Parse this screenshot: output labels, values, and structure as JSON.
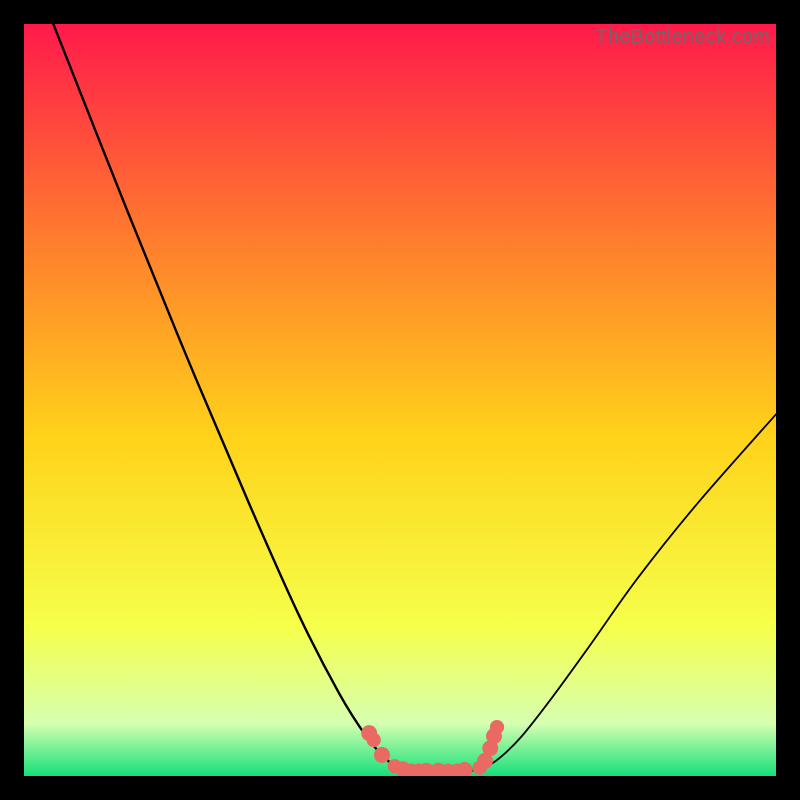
{
  "watermark": "TheBottleneck.com",
  "palette": {
    "bg": "#000000",
    "curve": "#000000",
    "marker": "#e86a63",
    "gradient_top": "#ff1a4b",
    "gradient_upper_mid": "#ff7a2e",
    "gradient_mid": "#ffd31a",
    "gradient_lower_mid": "#f6ff4a",
    "gradient_band_light": "#d6ffb0",
    "gradient_bottom": "#15e07a"
  },
  "chart_data": {
    "type": "line",
    "title": "",
    "xlabel": "",
    "ylabel": "",
    "xlim": [
      0,
      100
    ],
    "ylim": [
      0,
      100
    ],
    "note": "Axes are unlabeled; values read proportionally from pixel positions (0–100 scale, origin at bottom-left of the gradient area).",
    "series": [
      {
        "name": "left-curve",
        "x": [
          3.9,
          13.8,
          22.0,
          29.9,
          36.6,
          41.9,
          45.5,
          48.1,
          49.5,
          50.5,
          52.1,
          53.9
        ],
        "y": [
          100.0,
          75.0,
          54.9,
          36.3,
          21.3,
          11.0,
          5.3,
          2.3,
          1.3,
          0.8,
          0.5,
          0.5
        ]
      },
      {
        "name": "right-curve",
        "x": [
          56.6,
          59.6,
          61.6,
          63.6,
          66.2,
          70.2,
          75.0,
          81.6,
          89.6,
          100.0
        ],
        "y": [
          0.5,
          0.7,
          1.3,
          2.7,
          5.3,
          10.4,
          17.0,
          26.3,
          36.3,
          48.1
        ]
      }
    ],
    "markers": [
      {
        "x": 45.9,
        "y": 5.7,
        "r": 1.2
      },
      {
        "x": 46.5,
        "y": 4.8,
        "r": 1.0
      },
      {
        "x": 47.6,
        "y": 2.8,
        "r": 1.2
      },
      {
        "x": 49.3,
        "y": 1.3,
        "r": 1.0
      },
      {
        "x": 50.4,
        "y": 0.9,
        "r": 1.2
      },
      {
        "x": 51.5,
        "y": 0.7,
        "r": 1.0
      },
      {
        "x": 52.5,
        "y": 0.7,
        "r": 1.0
      },
      {
        "x": 53.5,
        "y": 0.7,
        "r": 1.2
      },
      {
        "x": 55.1,
        "y": 0.7,
        "r": 1.2
      },
      {
        "x": 56.4,
        "y": 0.7,
        "r": 1.0
      },
      {
        "x": 57.6,
        "y": 0.7,
        "r": 1.0
      },
      {
        "x": 58.6,
        "y": 0.8,
        "r": 1.2
      },
      {
        "x": 60.6,
        "y": 1.1,
        "r": 1.0
      },
      {
        "x": 61.3,
        "y": 2.0,
        "r": 1.2
      },
      {
        "x": 62.0,
        "y": 3.7,
        "r": 1.2
      },
      {
        "x": 62.5,
        "y": 5.3,
        "r": 1.2
      },
      {
        "x": 62.9,
        "y": 6.5,
        "r": 1.0
      }
    ],
    "gradient_stops_pct_from_top": [
      {
        "pct": 0,
        "color": "#ff1a4b"
      },
      {
        "pct": 28,
        "color": "#ff7a2e"
      },
      {
        "pct": 55,
        "color": "#ffd31a"
      },
      {
        "pct": 80,
        "color": "#f6ff4a"
      },
      {
        "pct": 93,
        "color": "#d6ffb0"
      },
      {
        "pct": 100,
        "color": "#15e07a"
      }
    ]
  }
}
